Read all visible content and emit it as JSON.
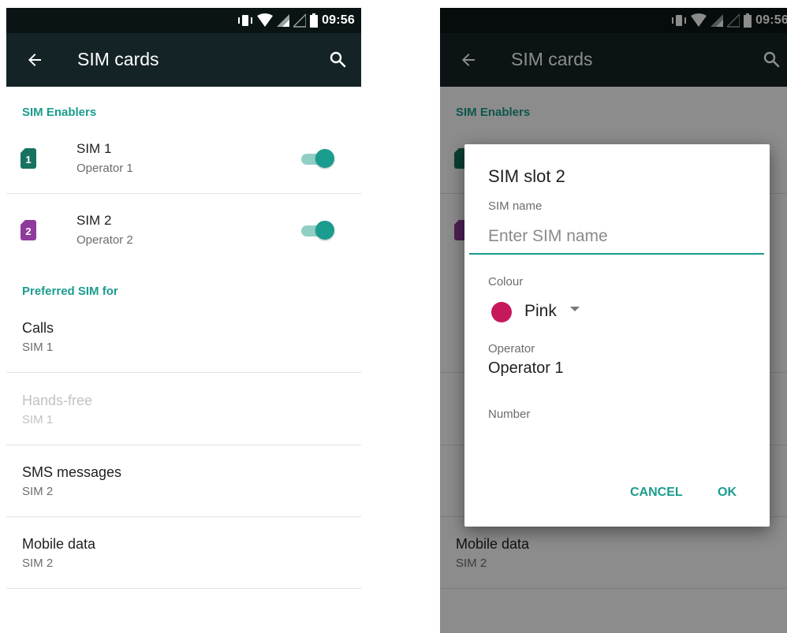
{
  "status_bar": {
    "time": "09:56"
  },
  "toolbar": {
    "title": "SIM cards",
    "back_icon": "arrow-back-icon",
    "search_icon": "search-icon"
  },
  "sim_enablers": {
    "header": "SIM Enablers",
    "items": [
      {
        "number": "1",
        "name": "SIM 1",
        "operator": "Operator 1",
        "enabled": true,
        "icon_color": "#17735f"
      },
      {
        "number": "2",
        "name": "SIM 2",
        "operator": "Operator 2",
        "enabled": true,
        "icon_color": "#8e3b9b"
      }
    ]
  },
  "preferred": {
    "header": "Preferred SIM for",
    "items": [
      {
        "label": "Calls",
        "value": "SIM 1",
        "disabled": false
      },
      {
        "label": "Hands-free",
        "value": "SIM 1",
        "disabled": true
      },
      {
        "label": "SMS messages",
        "value": "SIM 2",
        "disabled": false
      },
      {
        "label": "Mobile data",
        "value": "SIM 2",
        "disabled": false
      }
    ]
  },
  "dialog": {
    "title": "SIM slot 2",
    "sim_name_label": "SIM name",
    "sim_name_placeholder": "Enter SIM name",
    "sim_name_value": "",
    "colour_label": "Colour",
    "colour_value": "Pink",
    "colour_hex": "#c6195c",
    "operator_label": "Operator",
    "operator_value": "Operator 1",
    "number_label": "Number",
    "cancel_label": "CANCEL",
    "ok_label": "OK"
  },
  "colors": {
    "accent": "#1a9c8e",
    "toolbar": "#142426",
    "statusbar": "#0b1415"
  }
}
